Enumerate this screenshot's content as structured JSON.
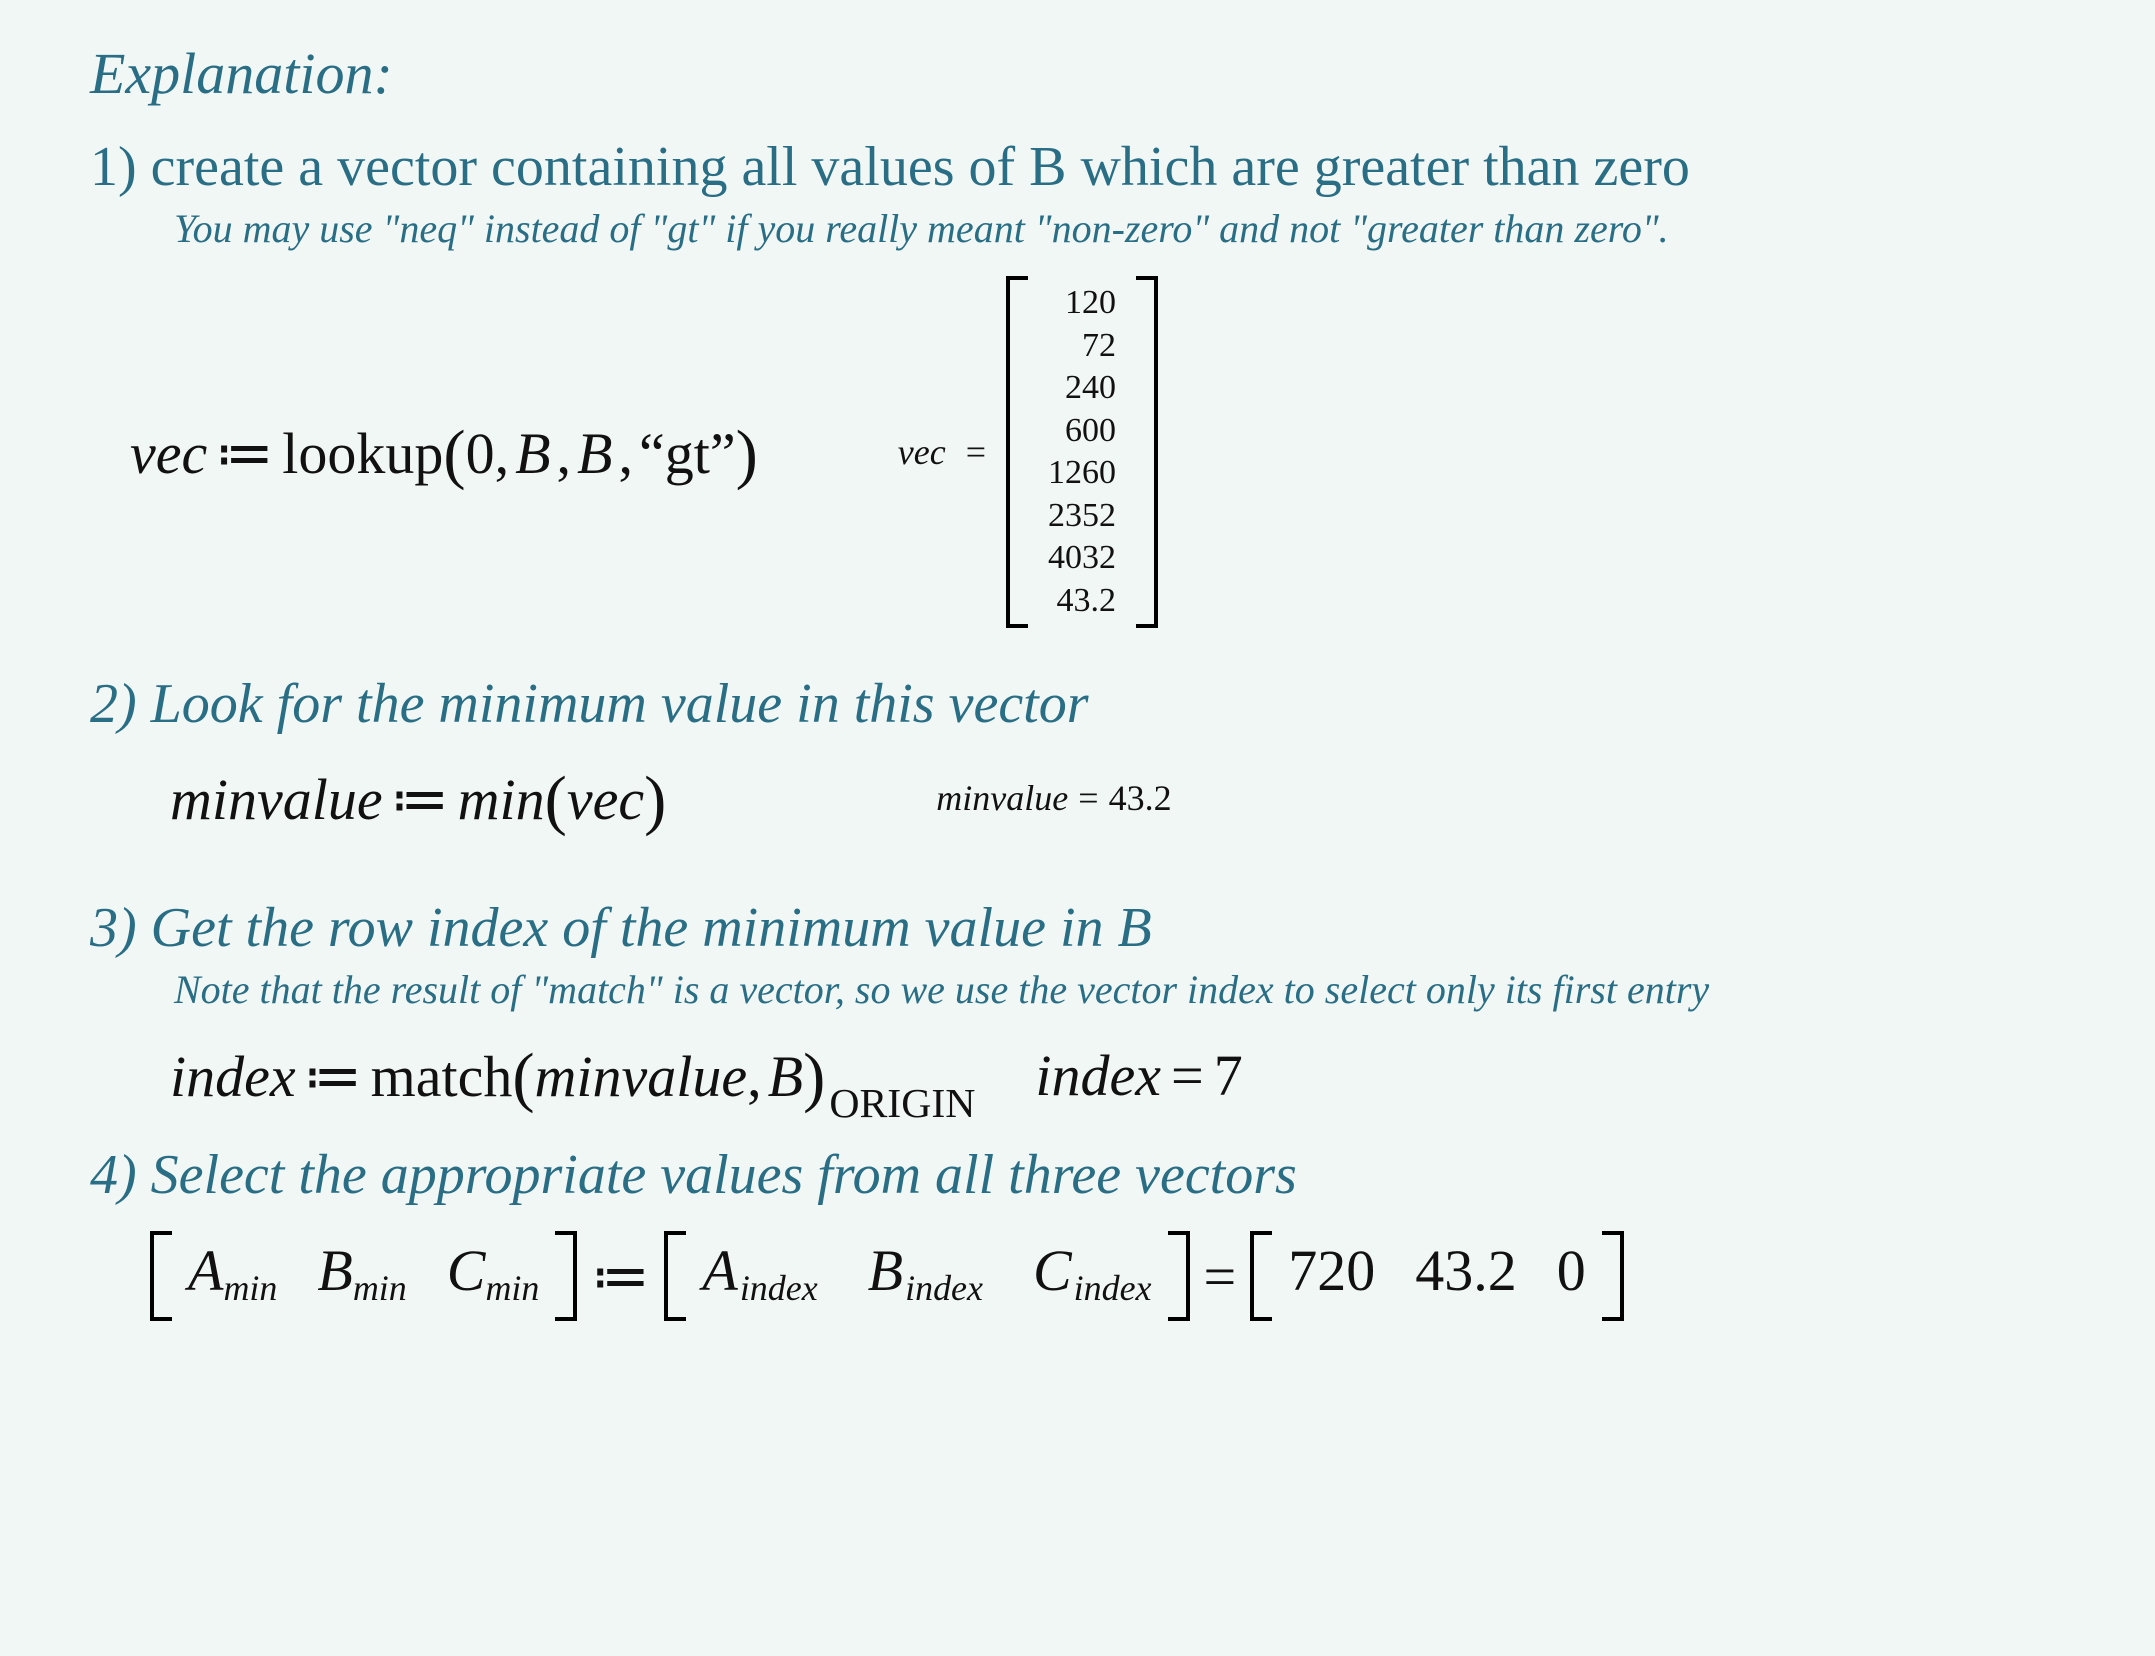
{
  "heading": "Explanation:",
  "step1": {
    "num": "1)",
    "title_rest": "create a vector containing all values of B which are greater than zero",
    "subnote": "You may use \"neq\" instead of \"gt\" if you really meant \"non-zero\" and not \"greater than zero\".",
    "lhs": "vec",
    "assign": "≔",
    "func": "lookup",
    "lparen": "(",
    "arg0": "0",
    "comma": ",",
    "argB1": "B",
    "argB2": "B",
    "qopen": "“",
    "gt": "gt",
    "qclose": "”",
    "rparen": ")",
    "res_lhs": "vec",
    "res_eq": "=",
    "vector": [
      "120",
      "72",
      "240",
      "600",
      "1260",
      "2352",
      "4032",
      "43.2"
    ]
  },
  "step2": {
    "num": "2)",
    "title_rest": "Look for the minimum value in this vector",
    "lhs": "minvalue",
    "assign": "≔",
    "func": "min",
    "lparen": "(",
    "arg": "vec",
    "rparen": ")",
    "res_lhs": "minvalue",
    "res_eq": "=",
    "res_val": "43.2"
  },
  "step3": {
    "num": "3)",
    "title_rest": "Get the row index of the minimum value in B",
    "subnote": "Note that the result of \"match\" is a vector, so we use the vector index to select only its first entry",
    "lhs": "index",
    "assign": "≔",
    "func": "match",
    "lparen": "(",
    "arg1": "minvalue",
    "comma": ",",
    "arg2": "B",
    "rparen": ")",
    "subscript": "ORIGIN",
    "res_lhs": "index",
    "res_eq": "=",
    "res_val": "7"
  },
  "step4": {
    "num": "4)",
    "title_rest": "Select the appropriate values from all three vectors",
    "A": "A",
    "B": "B",
    "C": "C",
    "min": "min",
    "index": "index",
    "assign": "≔",
    "eq": "=",
    "v1": "720",
    "v2": "43.2",
    "v3": "0"
  }
}
